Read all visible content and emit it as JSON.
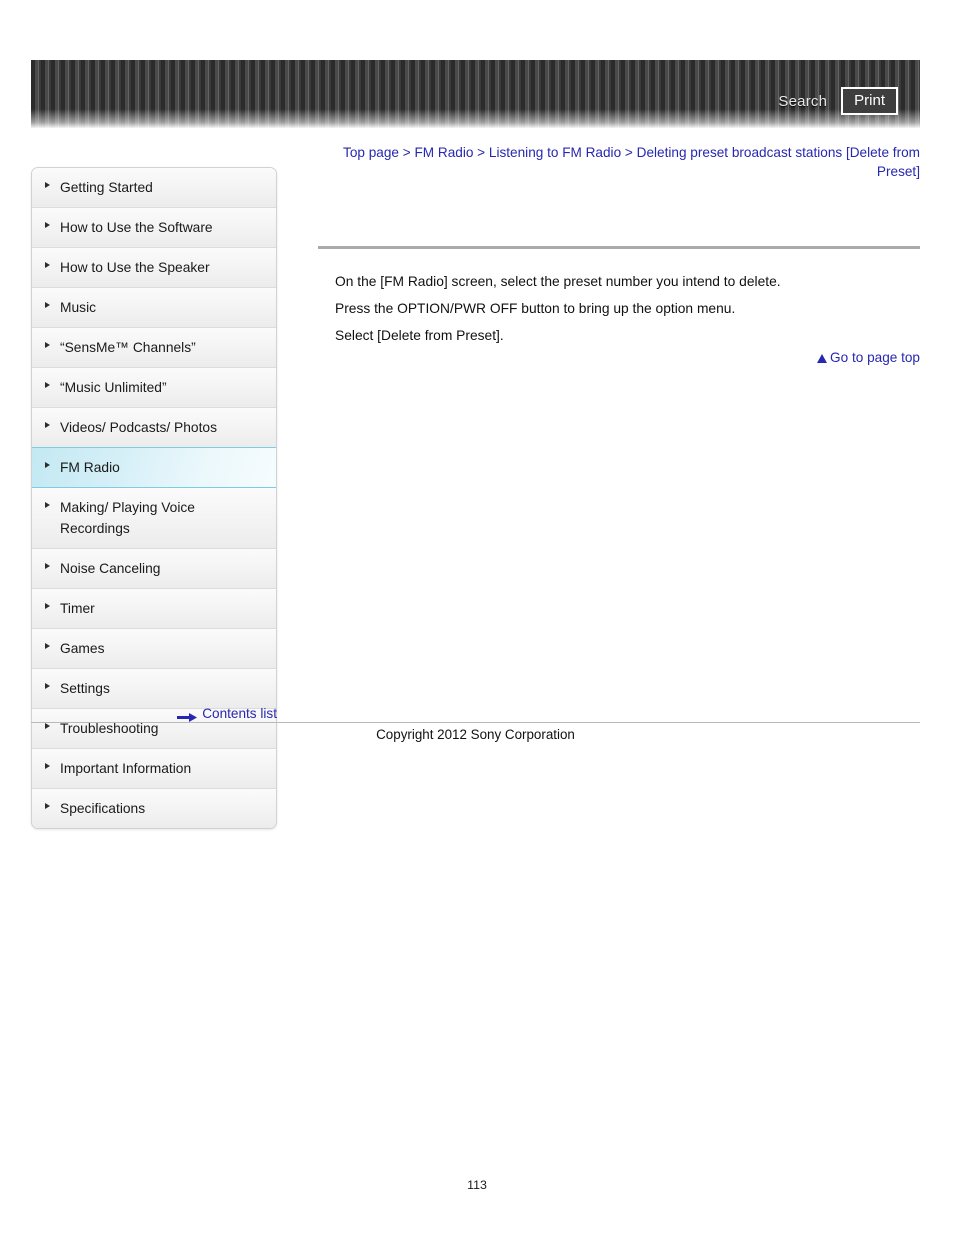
{
  "header": {
    "search_label": "Search",
    "print_label": "Print",
    "search_icon": "search-icon",
    "print_icon": "printer-icon"
  },
  "breadcrumb": {
    "separator": ">",
    "items": [
      "Top page",
      "FM Radio",
      "Listening to FM Radio",
      "Deleting preset broadcast stations [Delete from Preset]"
    ]
  },
  "sidebar": {
    "bullet_icon": "triangle-right-icon",
    "items": [
      {
        "label": "Getting Started",
        "active": false
      },
      {
        "label": "How to Use the Software",
        "active": false
      },
      {
        "label": "How to Use the Speaker",
        "active": false
      },
      {
        "label": "Music",
        "active": false
      },
      {
        "label": "“SensMe™ Channels”",
        "active": false
      },
      {
        "label": "“Music Unlimited”",
        "active": false
      },
      {
        "label": "Videos/ Podcasts/ Photos",
        "active": false
      },
      {
        "label": "FM Radio",
        "active": true
      },
      {
        "label": "Making/ Playing Voice Recordings",
        "active": false
      },
      {
        "label": "Noise Canceling",
        "active": false
      },
      {
        "label": "Timer",
        "active": false
      },
      {
        "label": "Games",
        "active": false
      },
      {
        "label": "Settings",
        "active": false
      },
      {
        "label": "Troubleshooting",
        "active": false
      },
      {
        "label": "Important Information",
        "active": false
      },
      {
        "label": "Specifications",
        "active": false
      }
    ],
    "contents_list_label": "Contents list",
    "contents_list_icon": "arrow-right-icon"
  },
  "main": {
    "paragraphs": [
      "On the [FM Radio] screen, select the preset number you intend to delete.",
      "Press the OPTION/PWR OFF button to bring up the option menu.",
      "Select [Delete from Preset]."
    ],
    "go_top_label": "Go to page top",
    "go_top_icon": "triangle-up-icon"
  },
  "footer": {
    "copyright": "Copyright 2012 Sony Corporation",
    "page_number": "113"
  },
  "colors": {
    "link": "#2727b0",
    "active_nav": "#c3e9f3",
    "rule": "#aaaaaa",
    "banner_dark": "#2b2b2b"
  }
}
